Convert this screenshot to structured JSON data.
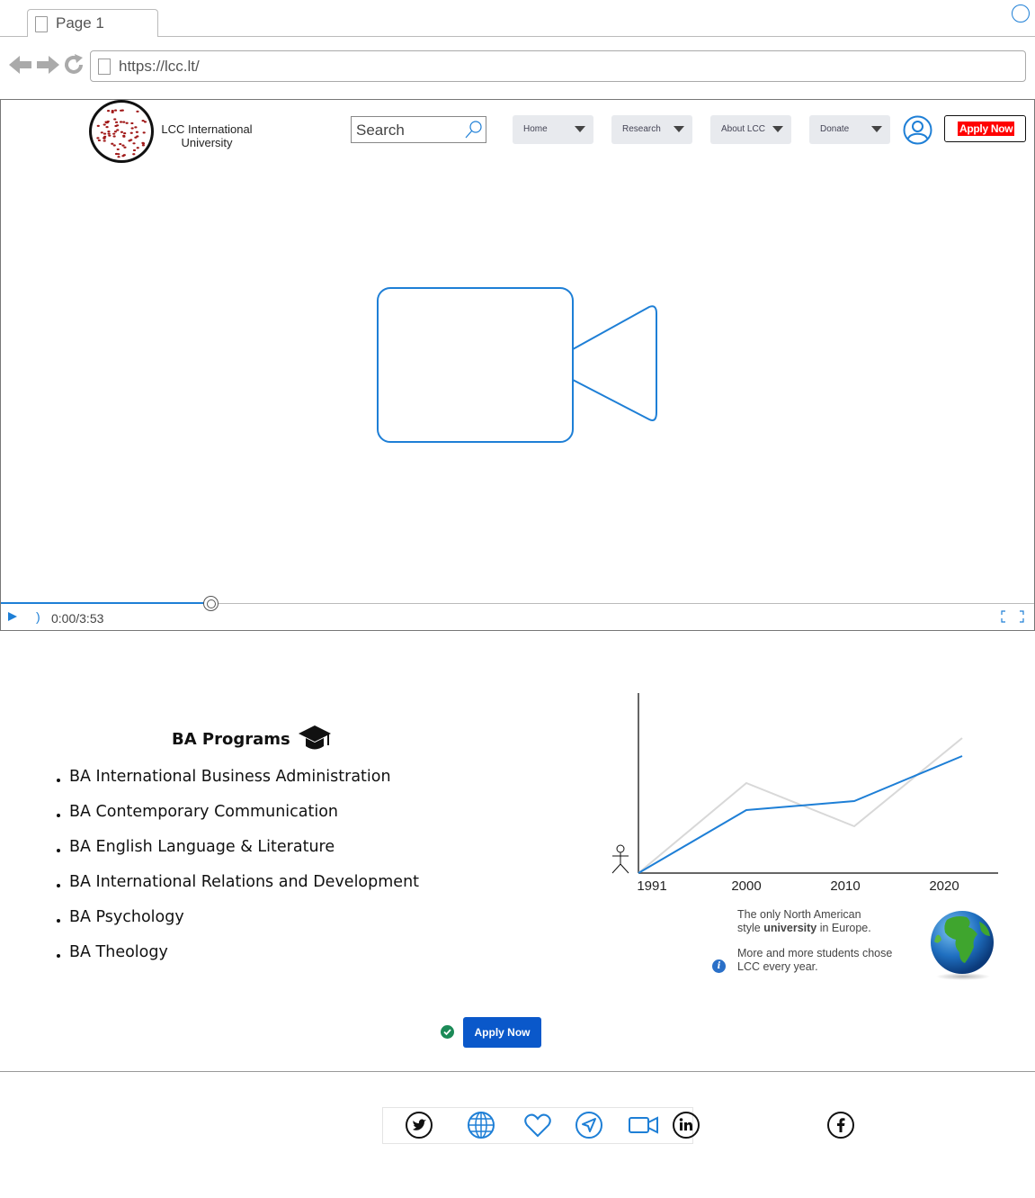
{
  "browser": {
    "tab_title": "Page 1",
    "url": "https://lcc.lt/"
  },
  "header": {
    "logo_text": "LCC International University",
    "search_placeholder": "Search",
    "menus": [
      {
        "label": "Home"
      },
      {
        "label": "Research"
      },
      {
        "label": "About LCC"
      },
      {
        "label": "Donate"
      }
    ],
    "apply_label": "Apply Now"
  },
  "video": {
    "time": "0:00/3:53",
    "progress": 0.2
  },
  "programs": {
    "title": "BA Programs",
    "items": [
      "BA International Business Administration",
      "BA Contemporary Communication",
      "BA English Language & Literature",
      "BA International Relations and Development",
      "BA Psychology",
      "BA Theology"
    ]
  },
  "chart_data": {
    "type": "line",
    "x_ticks": [
      "1991",
      "2000",
      "2010",
      "2020"
    ],
    "series": [
      {
        "values": [
          0,
          3.5,
          4,
          6.5
        ],
        "color": "#1e7fd6"
      },
      {
        "values": [
          0,
          5,
          2.6,
          7.5
        ],
        "color": "#d8d8d8"
      }
    ],
    "ylim": [
      0,
      10
    ],
    "grid": false
  },
  "info": {
    "line1": "The only North American",
    "line2_pre": "style ",
    "line2_bold": "university",
    "line2_post": " in Europe.",
    "line3": "More and more students chose",
    "line4": "LCC every year."
  },
  "cta": {
    "apply_label": "Apply Now"
  },
  "social": [
    "twitter-icon",
    "globe-icon",
    "heart-icon",
    "navigation-icon",
    "video-icon",
    "linkedin-icon",
    "facebook-icon"
  ],
  "colors": {
    "accent": "#1e7fd6",
    "apply_red": "#ff0000",
    "apply_blue": "#0a58ca"
  }
}
